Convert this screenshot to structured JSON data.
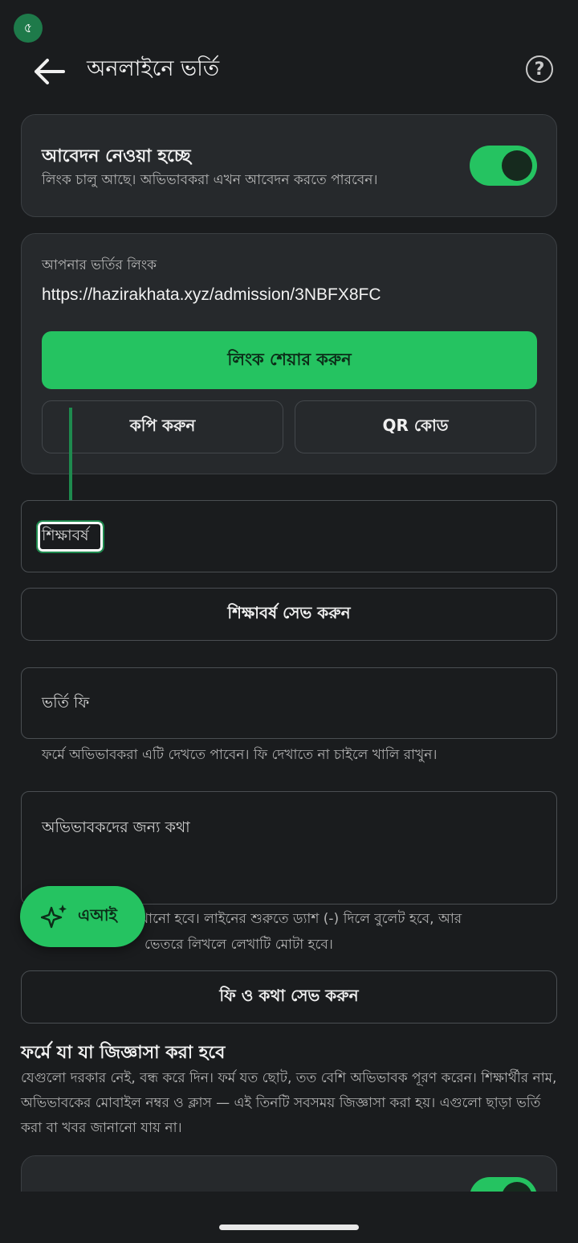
{
  "status": {
    "avatar_label": "৫"
  },
  "header": {
    "title": "অনলাইনে ভর্তি"
  },
  "applications": {
    "title": "আবেদন নেওয়া হচ্ছে",
    "subtitle": "লিংক চালু আছে। অভিভাবকরা এখন আবেদন করতে পারবেন।",
    "toggle_on": true
  },
  "link_card": {
    "label": "আপনার ভর্তির লিংক",
    "url": "https://hazirakhata.xyz/admission/3NBFX8FC",
    "share_label": "লিংক শেয়ার করুন",
    "copy_label": "কপি করুন",
    "qr_label": "QR কোড"
  },
  "academic_year": {
    "placeholder": "শিক্ষাবর্ষ",
    "save_label": "শিক্ষাবর্ষ সেভ করুন"
  },
  "fee": {
    "placeholder": "ভর্তি ফি",
    "helper": "ফর্মে অভিভাবকরা এটি দেখতে পাবেন। ফি দেখাতে না চাইলে খালি রাখুন।"
  },
  "note": {
    "placeholder": "অভিভাবকদের জন্য কথা",
    "helper_line1": "খানো হবে। লাইনের শুরুতে ড্যাশ (-) দিলে বুলেট হবে, আর",
    "helper_line2": "ভেতরে লিখলে লেখাটি মোটা হবে।"
  },
  "save_fee_note_label": "ফি ও কথা সেভ করুন",
  "questions": {
    "title": "ফর্মে যা যা জিজ্ঞাসা করা হবে",
    "description": "যেগুলো দরকার নেই, বন্ধ করে দিন। ফর্ম যত ছোট, তত বেশি অভিভাবক পূরণ করেন। শিক্ষার্থীর নাম, অভিভাবকের মোবাইল নম্বর ও ক্লাস — এই তিনটি সবসময় জিজ্ঞাসা করা হয়। এগুলো ছাড়া ভর্তি করা বা খবর জানানো যায় না।"
  },
  "fab": {
    "label": "এআই"
  },
  "colors": {
    "accent": "#25c361",
    "background": "#1a1c1e",
    "card": "#26292c"
  }
}
